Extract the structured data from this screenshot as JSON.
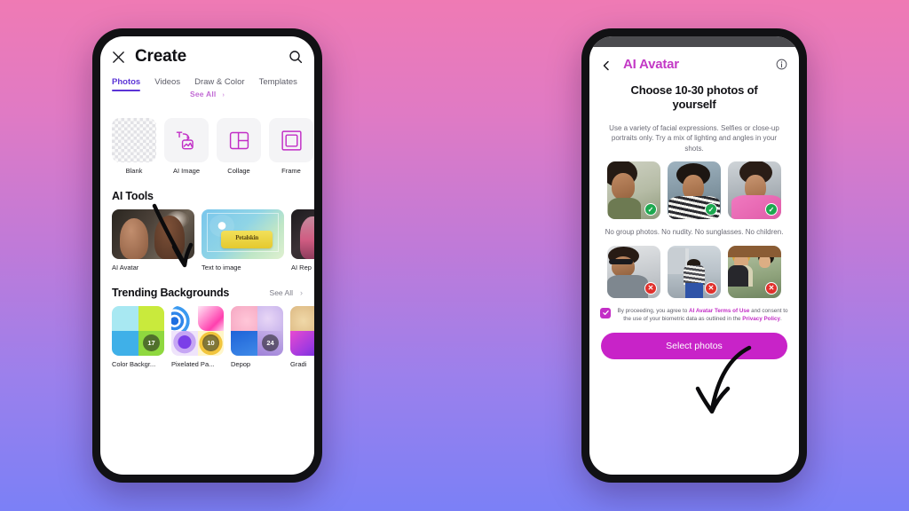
{
  "background": {
    "gradient_top": "#ef7ab4",
    "gradient_bottom": "#7b80f6"
  },
  "left_phone": {
    "header": {
      "close_icon": "close-icon",
      "title": "Create",
      "search_icon": "search-icon"
    },
    "tabs": [
      {
        "label": "Photos",
        "active": true
      },
      {
        "label": "Videos",
        "active": false
      },
      {
        "label": "Draw & Color",
        "active": false
      },
      {
        "label": "Templates",
        "active": false
      }
    ],
    "floating_see_all": "See All",
    "templates": [
      {
        "label": "Blank",
        "icon": "checkerboard-icon"
      },
      {
        "label": "AI Image",
        "icon": "text-to-image-icon"
      },
      {
        "label": "Collage",
        "icon": "collage-grid-icon"
      },
      {
        "label": "Frame",
        "icon": "frame-icon"
      }
    ],
    "ai_tools": {
      "title": "AI Tools",
      "items": [
        {
          "label": "AI Avatar"
        },
        {
          "label": "Text to image",
          "art_text": "Petalskin"
        },
        {
          "label": "AI Rep"
        }
      ]
    },
    "trending": {
      "title": "Trending Backgrounds",
      "see_all": "See All",
      "items": [
        {
          "label": "Color Backgr...",
          "badge": "17"
        },
        {
          "label": "Pixelated Pa...",
          "badge": "10"
        },
        {
          "label": "Depop",
          "badge": "24"
        },
        {
          "label": "Gradi",
          "badge": ""
        }
      ]
    }
  },
  "right_phone": {
    "status_bar": {
      "time": "",
      "right": ""
    },
    "header": {
      "back_icon": "back-chevron-icon",
      "title": "AI Avatar",
      "info_icon": "info-icon"
    },
    "heading": "Choose 10-30 photos of yourself",
    "subtext": "Use a variety of facial expressions. Selfies or close-up portraits only. Try a mix of lighting and angles in your shots.",
    "good_examples": [
      {
        "badge": "check",
        "badge_glyph": "✓"
      },
      {
        "badge": "check",
        "badge_glyph": "✓"
      },
      {
        "badge": "check",
        "badge_glyph": "✓"
      }
    ],
    "note": "No group photos. No nudity. No sunglasses. No children.",
    "bad_examples": [
      {
        "badge": "cross",
        "badge_glyph": "✕"
      },
      {
        "badge": "cross",
        "badge_glyph": "✕"
      },
      {
        "badge": "cross",
        "badge_glyph": "✕"
      }
    ],
    "consent": {
      "checked": true,
      "text_before": "By proceeding, you agree to ",
      "link1": "AI Avatar Terms of Use",
      "text_middle": " and consent to the use of your biometric data as outlined in the ",
      "link2": "Privacy Policy",
      "text_after": "."
    },
    "cta_label": "Select photos"
  },
  "annotations": {
    "arrow_left": "hand-drawn-arrow-pointing-to-ai-tools",
    "arrow_right": "hand-drawn-arrow-pointing-to-select-photos"
  }
}
